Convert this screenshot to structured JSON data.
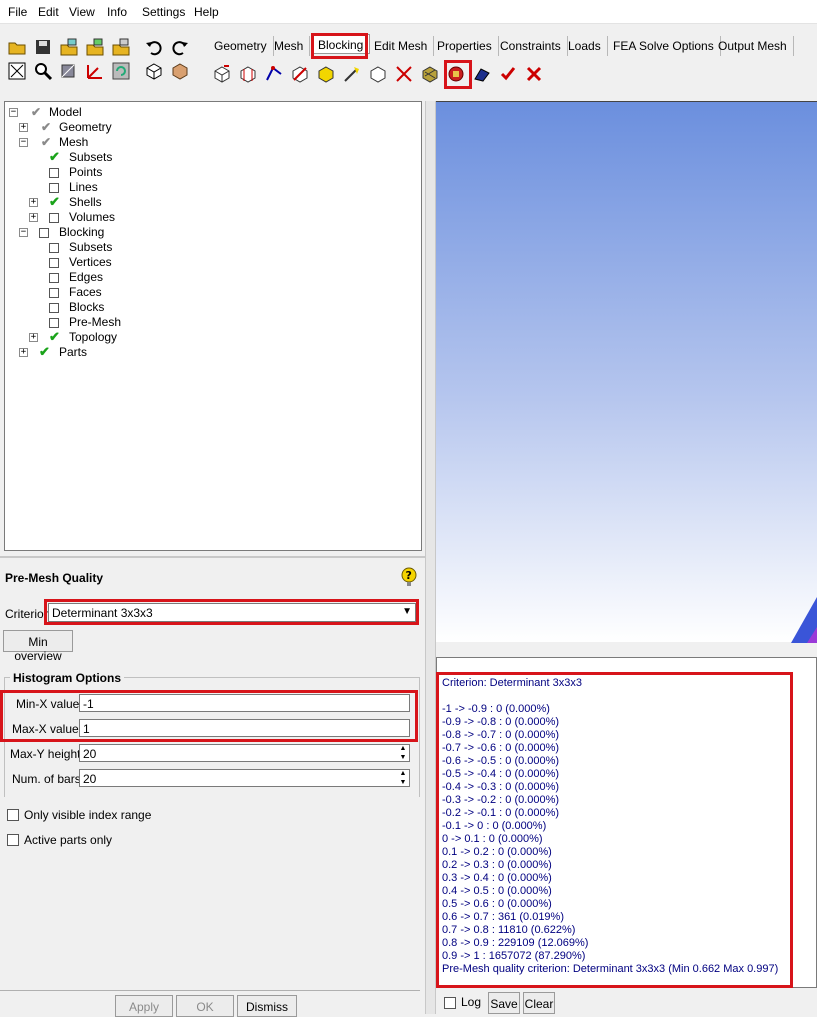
{
  "menu": [
    "File",
    "Edit",
    "View",
    "Info",
    "Settings",
    "Help"
  ],
  "tabs": [
    "Geometry",
    "Mesh",
    "Blocking",
    "Edit Mesh",
    "Properties",
    "Constraints",
    "Loads",
    "FEA Solve Options",
    "Output Mesh"
  ],
  "active_tab": "Blocking",
  "tree": [
    {
      "label": "Model",
      "name": "tree-item-model"
    },
    {
      "label": "Geometry",
      "name": "tree-item-geometry"
    },
    {
      "label": "Mesh",
      "name": "tree-item-mesh"
    },
    {
      "label": "Subsets",
      "name": "tree-item-mesh-subsets"
    },
    {
      "label": "Points",
      "name": "tree-item-points"
    },
    {
      "label": "Lines",
      "name": "tree-item-lines"
    },
    {
      "label": "Shells",
      "name": "tree-item-shells"
    },
    {
      "label": "Volumes",
      "name": "tree-item-volumes"
    },
    {
      "label": "Blocking",
      "name": "tree-item-blocking"
    },
    {
      "label": "Subsets",
      "name": "tree-item-blocking-subsets"
    },
    {
      "label": "Vertices",
      "name": "tree-item-vertices"
    },
    {
      "label": "Edges",
      "name": "tree-item-edges"
    },
    {
      "label": "Faces",
      "name": "tree-item-faces"
    },
    {
      "label": "Blocks",
      "name": "tree-item-blocks"
    },
    {
      "label": "Pre-Mesh",
      "name": "tree-item-pre-mesh"
    },
    {
      "label": "Topology",
      "name": "tree-item-topology"
    },
    {
      "label": "Parts",
      "name": "tree-item-parts"
    }
  ],
  "panel": {
    "title": "Pre-Mesh Quality",
    "criterion_label": "Criterion",
    "criterion_value": "Determinant 3x3x3",
    "min_overview": "Min overview",
    "histogram_title": "Histogram Options",
    "minx_label": "Min-X value",
    "minx_value": "-1",
    "maxx_label": "Max-X value",
    "maxx_value": "1",
    "maxy_label": "Max-Y height",
    "maxy_value": "20",
    "bars_label": "Num. of bars",
    "bars_value": "20",
    "only_visible": "Only visible index range",
    "active_parts": "Active parts only",
    "apply": "Apply",
    "ok": "OK",
    "dismiss": "Dismiss"
  },
  "output": {
    "lines": [
      "Criterion: Determinant 3x3x3",
      "",
      "-1 -> -0.9 : 0 (0.000%)",
      "-0.9 -> -0.8 : 0 (0.000%)",
      "-0.8 -> -0.7 : 0 (0.000%)",
      "-0.7 -> -0.6 : 0 (0.000%)",
      "-0.6 -> -0.5 : 0 (0.000%)",
      "-0.5 -> -0.4 : 0 (0.000%)",
      "-0.4 -> -0.3 : 0 (0.000%)",
      "-0.3 -> -0.2 : 0 (0.000%)",
      "-0.2 -> -0.1 : 0 (0.000%)",
      "-0.1 -> 0 : 0 (0.000%)",
      "0 -> 0.1 : 0 (0.000%)",
      "0.1 -> 0.2 : 0 (0.000%)",
      "0.2 -> 0.3 : 0 (0.000%)",
      "0.3 -> 0.4 : 0 (0.000%)",
      "0.4 -> 0.5 : 0 (0.000%)",
      "0.5 -> 0.6 : 0 (0.000%)",
      "0.6 -> 0.7 : 361 (0.019%)",
      "0.7 -> 0.8 : 11810 (0.622%)",
      "0.8 -> 0.9 : 229109 (12.069%)",
      "0.9 -> 1 : 1657072 (87.290%)",
      "Pre-Mesh quality criterion: Determinant 3x3x3 (Min 0.662 Max 0.997)"
    ],
    "log_label": "Log",
    "save_label": "Save",
    "clear_label": "Clear"
  },
  "colors": {
    "highlight": "#d7141a",
    "output_text": "#000080",
    "check": "#1aa31a"
  }
}
